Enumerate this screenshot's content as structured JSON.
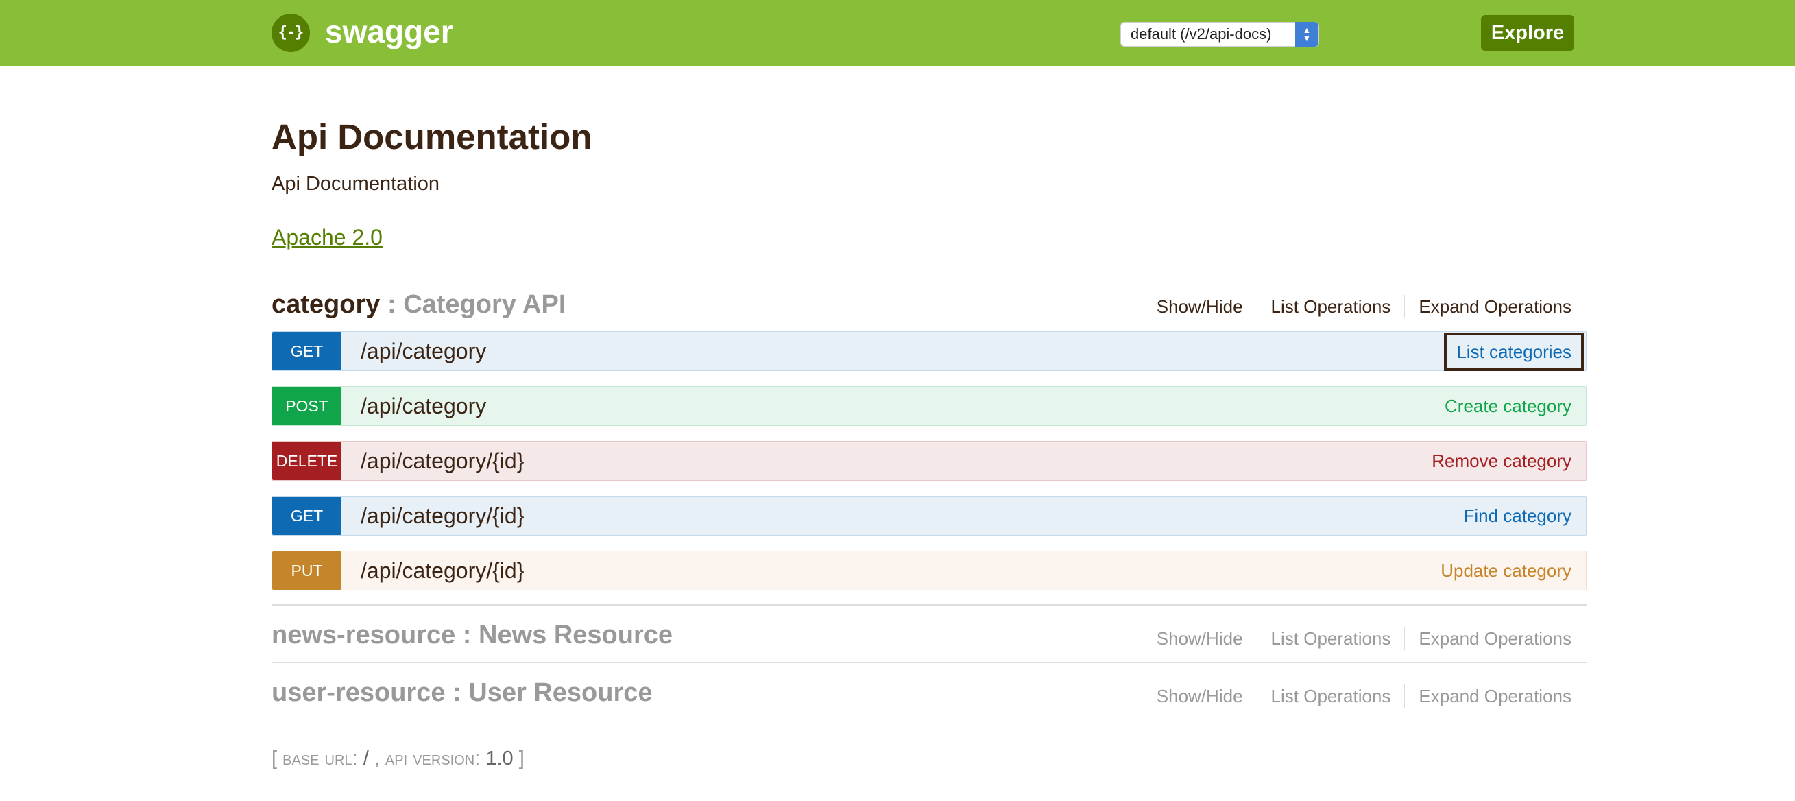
{
  "header": {
    "logo_glyph": "{-}",
    "logo_text": "swagger",
    "api_select_value": "default (/v2/api-docs)",
    "explore_label": "Explore",
    "colors": {
      "bar": "#89bf38",
      "dark_accent": "#547f00"
    }
  },
  "info": {
    "title": "Api Documentation",
    "description": "Api Documentation",
    "license": "Apache 2.0"
  },
  "actions": {
    "show_hide": "Show/Hide",
    "list_operations": "List Operations",
    "expand_operations": "Expand Operations"
  },
  "resources": [
    {
      "name": "category",
      "separator": " : ",
      "description": "Category API",
      "expanded": true,
      "operations": [
        {
          "method": "GET",
          "path": "/api/category",
          "summary": "List categories",
          "focused": true
        },
        {
          "method": "POST",
          "path": "/api/category",
          "summary": "Create category"
        },
        {
          "method": "DELETE",
          "path": "/api/category/{id}",
          "summary": "Remove category"
        },
        {
          "method": "GET",
          "path": "/api/category/{id}",
          "summary": "Find category"
        },
        {
          "method": "PUT",
          "path": "/api/category/{id}",
          "summary": "Update category"
        }
      ]
    },
    {
      "name": "news-resource",
      "separator": " : ",
      "description": "News Resource",
      "expanded": false
    },
    {
      "name": "user-resource",
      "separator": " : ",
      "description": "User Resource",
      "expanded": false
    }
  ],
  "footer": {
    "open": "[ ",
    "base_url_label": "base url",
    "colon": ": ",
    "base_url": "/",
    "comma": " , ",
    "api_version_label": "api version",
    "api_version": "1.0",
    "close": " ]"
  }
}
